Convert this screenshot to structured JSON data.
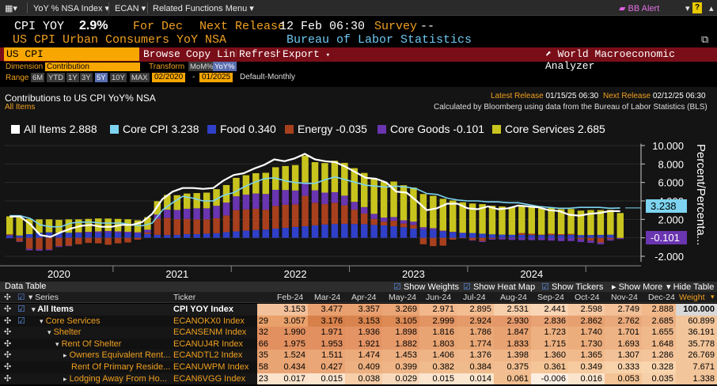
{
  "toolbar": {
    "menu1": "YoY % NSA Index",
    "menu2": "ECAN",
    "menu3": "Related Functions Menu",
    "alert": "BB Alert"
  },
  "header": {
    "ticker": "CPI YOY",
    "value": "2.9%",
    "for_label": "For Dec",
    "next_release_label": "Next Release",
    "next_release_value": "12 Feb 06:30",
    "survey_label": "Survey",
    "survey_value": "--",
    "name": "US CPI Urban Consumers YoY NSA",
    "source": "Bureau of Labor Statistics"
  },
  "actions": {
    "security": "US CPI",
    "browse": "Browse",
    "copy_link": "Copy Link",
    "refresh": "Refresh",
    "export": "Export",
    "analyzer": "World Macroeconomic Analyzer"
  },
  "controls": {
    "dimension_label": "Dimension",
    "dimension_value": "Contribution",
    "transform_label": "Transform",
    "transform_opts": [
      "MoM%",
      "YoY%"
    ],
    "range_label": "Range",
    "range_opts": [
      "6M",
      "YTD",
      "1Y",
      "3Y",
      "5Y",
      "10Y",
      "MAX"
    ],
    "range_active": "5Y",
    "start_date": "02/2020",
    "dash": "-",
    "end_date": "01/2025",
    "frequency": "Default-Monthly"
  },
  "chart": {
    "title": "Contributions to US CPI YoY% NSA",
    "subtitle": "All Items",
    "latest_release_label": "Latest Release",
    "latest_release_value": "01/15/25 06:30",
    "next_release_label": "Next Release",
    "next_release_value": "02/12/25 06:30",
    "note": "Calculated by Bloomberg using data from the Bureau of Labor Statistics (BLS)",
    "y_axis_label": "Percent/Percenta...",
    "end_label_core": "3.238",
    "end_label_goods": "-0.101"
  },
  "chart_data": {
    "type": "bar",
    "x_start": "2020-02",
    "x_end": "2025-01",
    "x_ticks": [
      "2020",
      "2021",
      "2022",
      "2023",
      "2024"
    ],
    "y_ticks": [
      "10.000",
      "8.000",
      "6.000",
      "4.000",
      "2.000",
      "0.000",
      "-2.000"
    ],
    "ylim": [
      -2.6,
      10.2
    ],
    "legend": [
      {
        "name": "All Items",
        "value": "2.888",
        "color": "#ffffff"
      },
      {
        "name": "Core CPI",
        "value": "3.238",
        "color": "#7dd3f0"
      },
      {
        "name": "Food",
        "value": "0.340",
        "color": "#3040c8"
      },
      {
        "name": "Energy",
        "value": "-0.035",
        "color": "#a8401e"
      },
      {
        "name": "Core Goods",
        "value": "-0.101",
        "color": "#6a35b0"
      },
      {
        "name": "Core Services",
        "value": "2.685",
        "color": "#c8c41e"
      }
    ],
    "series": {
      "food": [
        0.28,
        0.25,
        0.4,
        0.55,
        0.6,
        0.55,
        0.55,
        0.5,
        0.5,
        0.5,
        0.52,
        0.5,
        0.48,
        0.45,
        0.4,
        0.32,
        0.3,
        0.32,
        0.4,
        0.4,
        0.45,
        0.5,
        0.62,
        0.7,
        0.78,
        0.85,
        0.9,
        1.0,
        1.08,
        1.18,
        1.25,
        1.35,
        1.45,
        1.5,
        1.52,
        1.5,
        1.48,
        1.4,
        1.35,
        1.25,
        1.15,
        1.0,
        0.9,
        0.85,
        0.68,
        0.6,
        0.55,
        0.52,
        0.45,
        0.38,
        0.35,
        0.33,
        0.32,
        0.3,
        0.3,
        0.3,
        0.3,
        0.32,
        0.3,
        0.31,
        0.32,
        0.34
      ],
      "energy": [
        0.1,
        -0.4,
        -1.2,
        -1.25,
        -1.25,
        -0.9,
        -0.85,
        -0.7,
        -0.55,
        -0.6,
        -0.75,
        -0.6,
        -0.5,
        -0.2,
        0.18,
        1.75,
        1.85,
        1.7,
        1.65,
        1.6,
        1.55,
        1.62,
        1.8,
        2.3,
        2.3,
        2.3,
        2.15,
        2.45,
        2.5,
        2.45,
        3.3,
        2.45,
        2.2,
        2.3,
        2.0,
        1.55,
        1.15,
        0.65,
        0.4,
        0.6,
        0.4,
        0.4,
        -0.7,
        -0.9,
        -0.85,
        -0.2,
        -0.05,
        -0.25,
        -0.35,
        -0.1,
        -0.03,
        -0.03,
        0.2,
        0.15,
        0.05,
        0.15,
        0.1,
        0.1,
        -0.15,
        -0.3,
        -0.5,
        -0.15,
        -0.035
      ],
      "core_goods": [
        -0.05,
        -0.05,
        -0.15,
        -0.15,
        -0.1,
        -0.1,
        -0.05,
        0.1,
        0.15,
        0.2,
        0.22,
        0.2,
        0.18,
        0.15,
        0.3,
        0.45,
        0.9,
        1.0,
        1.1,
        1.2,
        1.2,
        1.35,
        1.4,
        1.5,
        1.6,
        1.65,
        1.7,
        1.75,
        1.6,
        1.5,
        1.45,
        1.35,
        1.25,
        1.15,
        1.05,
        0.85,
        0.7,
        0.55,
        0.45,
        0.4,
        0.35,
        0.35,
        0.25,
        0.2,
        0.1,
        0.05,
        0.0,
        -0.05,
        -0.1,
        -0.1,
        -0.15,
        -0.2,
        -0.25,
        -0.25,
        -0.25,
        -0.3,
        -0.35,
        -0.35,
        -0.3,
        -0.25,
        -0.2,
        -0.15,
        -0.101
      ],
      "core_services": [
        1.95,
        1.95,
        1.65,
        1.45,
        1.4,
        1.4,
        1.45,
        1.4,
        1.4,
        1.4,
        1.35,
        1.35,
        1.35,
        1.3,
        1.35,
        1.45,
        1.6,
        1.6,
        1.65,
        1.65,
        1.7,
        1.8,
        1.9,
        2.0,
        2.1,
        2.2,
        2.3,
        2.45,
        2.6,
        2.75,
        2.9,
        3.05,
        3.2,
        3.4,
        3.55,
        3.65,
        3.7,
        3.8,
        3.85,
        3.85,
        3.8,
        3.7,
        3.6,
        3.5,
        3.45,
        3.4,
        3.3,
        3.2,
        3.2,
        3.1,
        3.05,
        3.0,
        2.95,
        2.9,
        2.85,
        2.8,
        2.7,
        2.7,
        2.65,
        2.7,
        2.69,
        2.685,
        2.685
      ],
      "all_items": [
        2.3,
        2.3,
        1.5,
        0.3,
        0.1,
        0.6,
        1.0,
        1.3,
        1.4,
        1.2,
        1.2,
        1.4,
        1.4,
        1.7,
        2.6,
        4.2,
        5.0,
        5.4,
        5.4,
        5.3,
        5.4,
        6.2,
        6.8,
        7.0,
        7.5,
        7.9,
        8.5,
        8.3,
        8.6,
        9.1,
        8.5,
        8.3,
        8.2,
        7.7,
        7.1,
        6.5,
        6.4,
        6.0,
        5.0,
        4.9,
        4.0,
        3.0,
        3.2,
        3.7,
        3.7,
        3.2,
        3.1,
        3.4,
        3.1,
        3.2,
        3.5,
        3.4,
        3.3,
        3.0,
        2.9,
        2.5,
        2.4,
        2.6,
        2.7,
        2.9,
        2.888
      ],
      "core_cpi": [
        2.4,
        2.4,
        2.1,
        1.4,
        1.2,
        1.2,
        1.6,
        1.7,
        1.7,
        1.6,
        1.6,
        1.6,
        1.4,
        1.3,
        1.6,
        3.0,
        3.8,
        4.5,
        4.3,
        4.0,
        4.0,
        4.6,
        4.9,
        5.5,
        6.0,
        6.4,
        6.5,
        6.2,
        6.0,
        5.9,
        5.9,
        6.3,
        6.6,
        6.3,
        6.0,
        5.7,
        5.6,
        5.5,
        5.6,
        5.5,
        5.3,
        4.8,
        4.7,
        4.3,
        4.1,
        4.0,
        4.0,
        3.9,
        3.9,
        3.8,
        3.8,
        3.6,
        3.4,
        3.3,
        3.2,
        3.2,
        3.3,
        3.3,
        3.3,
        3.2,
        3.238
      ]
    }
  },
  "table": {
    "title": "Data Table",
    "opts": [
      "Show Weights",
      "Show Heat Map",
      "Show Tickers",
      "Show More",
      "Hide Table"
    ],
    "col_series": "Series",
    "col_ticker": "Ticker",
    "months": [
      "Feb-24",
      "Mar-24",
      "Apr-24",
      "May-24",
      "Jun-24",
      "Jul-24",
      "Aug-24",
      "Sep-24",
      "Oct-24",
      "Nov-24",
      "Dec-24"
    ],
    "col_weight": "Weight",
    "rows": [
      {
        "name": "All Items",
        "ticker": "CPI YOY Index",
        "prev": "",
        "vals": [
          "3.153",
          "3.477",
          "3.357",
          "3.269",
          "2.971",
          "2.895",
          "2.531",
          "2.441",
          "2.598",
          "2.749",
          "2.888"
        ],
        "weight": "100.000"
      },
      {
        "name": "Core Services",
        "ticker": "ECANOKX0 Index",
        "prev": "29",
        "vals": [
          "3.057",
          "3.176",
          "3.153",
          "3.105",
          "2.999",
          "2.924",
          "2.930",
          "2.836",
          "2.862",
          "2.762",
          "2.685"
        ],
        "weight": "60.899"
      },
      {
        "name": "Shelter",
        "ticker": "ECANSENM Index",
        "prev": "32",
        "vals": [
          "1.990",
          "1.971",
          "1.936",
          "1.898",
          "1.816",
          "1.786",
          "1.847",
          "1.723",
          "1.740",
          "1.701",
          "1.655"
        ],
        "weight": "36.191"
      },
      {
        "name": "Rent Of Shelter",
        "ticker": "ECANUJ4R Index",
        "prev": "66",
        "vals": [
          "1.975",
          "1.953",
          "1.921",
          "1.882",
          "1.803",
          "1.774",
          "1.833",
          "1.715",
          "1.730",
          "1.693",
          "1.648"
        ],
        "weight": "35.778"
      },
      {
        "name": "Owners Equivalent Rent...",
        "ticker": "ECANDTL2 Index",
        "prev": "35",
        "vals": [
          "1.524",
          "1.511",
          "1.474",
          "1.453",
          "1.406",
          "1.376",
          "1.398",
          "1.360",
          "1.365",
          "1.307",
          "1.286"
        ],
        "weight": "26.769"
      },
      {
        "name": "Rent Of Primary Reside...",
        "ticker": "ECANUWPM Index",
        "prev": "58",
        "vals": [
          "0.434",
          "0.427",
          "0.409",
          "0.399",
          "0.382",
          "0.384",
          "0.375",
          "0.361",
          "0.349",
          "0.333",
          "0.328"
        ],
        "weight": "7.671"
      },
      {
        "name": "Lodging Away From Ho...",
        "ticker": "ECAN6VGG Index",
        "prev": "23",
        "vals": [
          "0.017",
          "0.015",
          "0.038",
          "0.029",
          "0.015",
          "0.014",
          "0.061",
          "-0.006",
          "0.016",
          "0.053",
          "0.035"
        ],
        "weight": "1.338"
      }
    ]
  }
}
